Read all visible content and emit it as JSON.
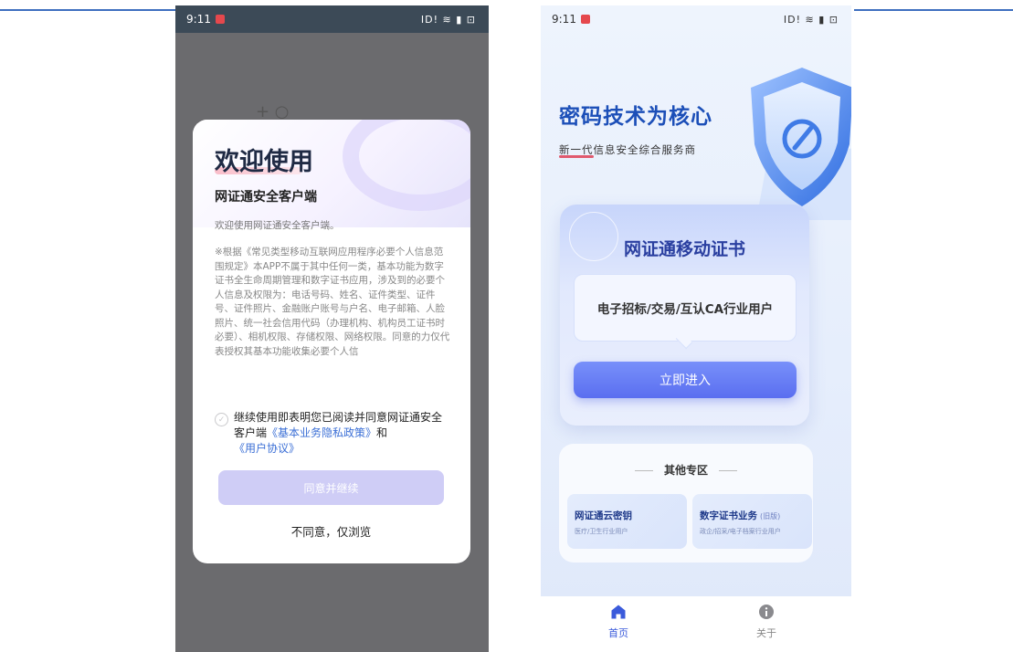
{
  "status_bar": {
    "time": "9:11",
    "icons": "ID! ≋ ▮ ⊡"
  },
  "consent_dialog": {
    "title": "欢迎使用",
    "subtitle": "网证通安全客户端",
    "intro": "欢迎使用网证通安全客户端。",
    "body": "※根据《常见类型移动互联网应用程序必要个人信息范围规定》本APP不属于其中任何一类，基本功能为数字证书全生命周期管理和数字证书应用，涉及到的必要个人信息及权限为：电话号码、姓名、证件类型、证件号、证件照片、金融账户账号与户名、电子邮箱、人脸照片、统一社会信用代码（办理机构、机构员工证书时必要）、相机权限、存储权限、网络权限。同意的力仅代表授权其基本功能收集必要个人信",
    "consent": {
      "prefix": "继续使用即表明您已阅读并同意网证通安全客户端",
      "privacy_link": "《基本业务隐私政策》",
      "and": "和",
      "agreement_link": "《用户协议》"
    },
    "agree_button": "同意并继续",
    "decline_button": "不同意，仅浏览"
  },
  "home": {
    "headline": "密码技术为核心",
    "tagline": "新一代信息安全综合服务商",
    "cert_card": {
      "title": "网证通移动证书",
      "description": "电子招标/交易/互认CA行业用户",
      "enter_button": "立即进入"
    },
    "other_zone": {
      "title": "其他专区",
      "tiles": [
        {
          "title": "网证通云密钥",
          "note": "",
          "desc": "医疗/卫生行业用户"
        },
        {
          "title": "数字证书业务",
          "note": "(旧版)",
          "desc": "政企/招采/电子档案行业用户"
        }
      ]
    }
  },
  "tab_bar": {
    "items": [
      {
        "label": "首页",
        "icon": "home-icon",
        "active": true
      },
      {
        "label": "关于",
        "icon": "info-icon",
        "active": false
      }
    ]
  },
  "colors": {
    "accent": "#5a6ef0",
    "headline_blue": "#1c4fb8",
    "link_blue": "#3b6fd6",
    "record_red": "#e5484d"
  }
}
